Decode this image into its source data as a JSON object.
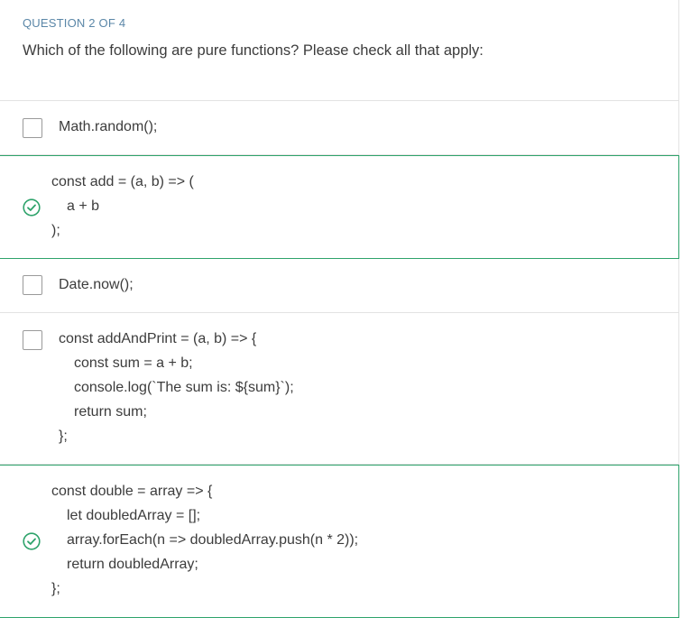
{
  "question": {
    "counter": "QUESTION 2 OF 4",
    "prompt": "Which of the following are pure functions? Please check all that apply:"
  },
  "options": [
    {
      "checked": false,
      "lines": [
        "Math.random();"
      ]
    },
    {
      "checked": true,
      "lines": [
        "const add = (a, b) => (",
        "a + b",
        ");"
      ]
    },
    {
      "checked": false,
      "lines": [
        "Date.now();"
      ]
    },
    {
      "checked": false,
      "lines": [
        "const addAndPrint = (a, b) => {",
        "const sum = a + b;",
        "console.log(`The sum is: ${sum}`);",
        "return sum;",
        "};"
      ]
    },
    {
      "checked": true,
      "lines": [
        "const double = array => {",
        "let doubledArray = [];",
        "array.forEach(n => doubledArray.push(n * 2));",
        "return doubledArray;",
        "};"
      ]
    }
  ],
  "colors": {
    "selected_border": "#2ea36b",
    "check_icon": "#2ea36b",
    "counter_text": "#5b87a8"
  },
  "icons": {
    "checked": "check-circle-icon",
    "unchecked": "empty-checkbox"
  }
}
